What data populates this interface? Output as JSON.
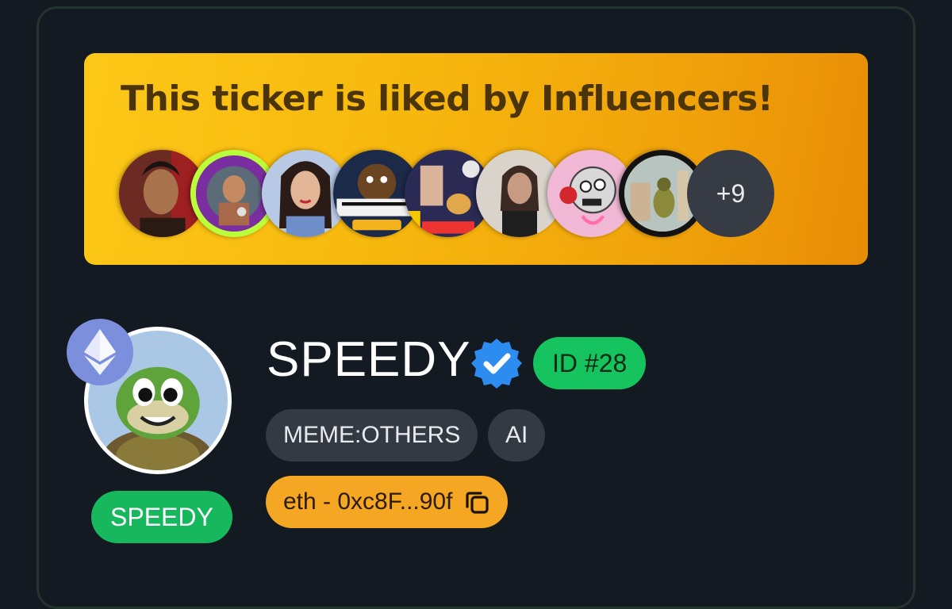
{
  "banner": {
    "title": "This ticker is liked by Influencers!",
    "influencers": [
      {
        "icon": "influencer-avatar-1",
        "color": "#6b2a22"
      },
      {
        "icon": "influencer-avatar-2",
        "color": "#b9ff3b"
      },
      {
        "icon": "influencer-avatar-3",
        "color": "#b8c9e6"
      },
      {
        "icon": "influencer-avatar-4",
        "color": "#1c2a4a"
      },
      {
        "icon": "influencer-avatar-5",
        "color": "#2a2a55"
      },
      {
        "icon": "influencer-avatar-6",
        "color": "#d9d3cc"
      },
      {
        "icon": "influencer-avatar-7",
        "color": "#f1b8d6"
      },
      {
        "icon": "influencer-avatar-8",
        "color": "#121212"
      }
    ],
    "more_count": "+9"
  },
  "token": {
    "name": "SPEEDY",
    "symbol": "SPEEDY",
    "id_label": "ID #28",
    "chain_icon": "ethereum-icon",
    "verified_icon": "verified-badge-icon",
    "tags": [
      "MEME:OTHERS",
      "AI"
    ],
    "address_label": "eth - 0xc8F...90f",
    "copy_icon": "copy-icon"
  },
  "colors": {
    "accent_green": "#15c45e",
    "banner_yellow": "#fcc817",
    "address_orange": "#f5a623",
    "background": "#131a22"
  }
}
